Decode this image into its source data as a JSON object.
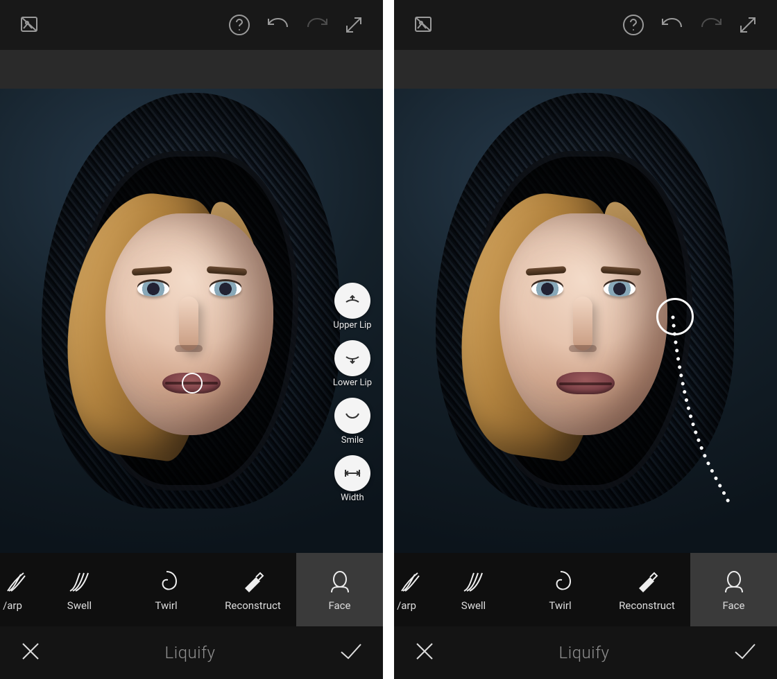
{
  "panes": [
    "left",
    "right"
  ],
  "topbar": {
    "icons": {
      "compare": "compare-original-icon",
      "help": "help-icon",
      "undo": "undo-icon",
      "redo": "redo-icon",
      "fullscreen": "fullscreen-icon"
    }
  },
  "face_options": [
    {
      "id": "upper-lip",
      "label": "Upper Lip"
    },
    {
      "id": "lower-lip",
      "label": "Lower Lip"
    },
    {
      "id": "smile",
      "label": "Smile"
    },
    {
      "id": "width",
      "label": "Width"
    }
  ],
  "tools": [
    {
      "id": "warp",
      "label": "Warp",
      "truncated": true
    },
    {
      "id": "swell",
      "label": "Swell"
    },
    {
      "id": "twirl",
      "label": "Twirl"
    },
    {
      "id": "reconstruct",
      "label": "Reconstruct"
    },
    {
      "id": "face",
      "label": "Face",
      "active": true
    }
  ],
  "bottom": {
    "title": "Liquify",
    "cancel_label": "Cancel",
    "apply_label": "Apply"
  },
  "overlays": {
    "mouth_ring": true,
    "swipe_gesture": true
  }
}
